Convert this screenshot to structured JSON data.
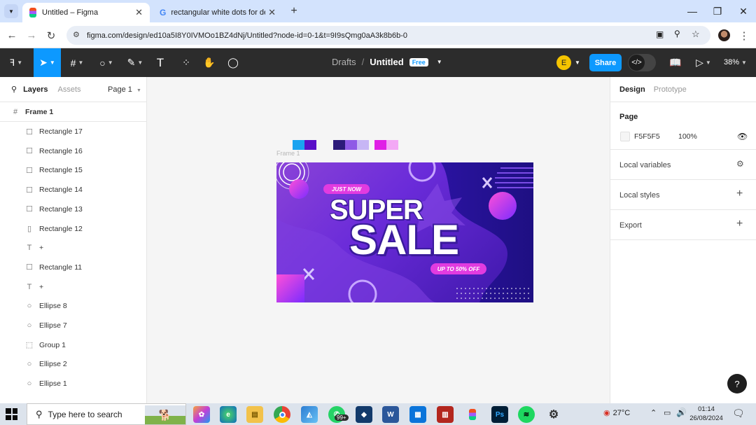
{
  "browser": {
    "tabs": [
      {
        "title": "Untitled – Figma",
        "active": true
      },
      {
        "title": "rectangular white dots for desi",
        "active": false
      }
    ],
    "url": "figma.com/design/ed10a5I8Y0IVMOo1BZ4dNj/Untitled?node-id=0-1&t=9I9sQmg0aA3k8b6b-0"
  },
  "toolbar": {
    "breadcrumb_drafts": "Drafts",
    "separator": "/",
    "file_name": "Untitled",
    "plan_badge": "Free",
    "avatar_initial": "E",
    "share_label": "Share",
    "zoom": "38%"
  },
  "left_panel": {
    "tabs": [
      "Layers",
      "Assets"
    ],
    "page_selector": "Page 1",
    "frame_name": "Frame 1",
    "layers": [
      {
        "name": "Rectangle 17",
        "icon": "rectangle-icon"
      },
      {
        "name": "Rectangle 16",
        "icon": "rectangle-icon"
      },
      {
        "name": "Rectangle 15",
        "icon": "rectangle-icon"
      },
      {
        "name": "Rectangle 14",
        "icon": "rectangle-icon"
      },
      {
        "name": "Rectangle 13",
        "icon": "rectangle-icon"
      },
      {
        "name": "Rectangle 12",
        "icon": "thin-rectangle-icon"
      },
      {
        "name": "+",
        "icon": "text-icon"
      },
      {
        "name": "Rectangle 11",
        "icon": "rectangle-icon"
      },
      {
        "name": "+",
        "icon": "text-icon"
      },
      {
        "name": "Ellipse 8",
        "icon": "ellipse-icon"
      },
      {
        "name": "Ellipse 7",
        "icon": "ellipse-icon"
      },
      {
        "name": "Group 1",
        "icon": "group-icon"
      },
      {
        "name": "Ellipse 2",
        "icon": "ellipse-icon"
      },
      {
        "name": "Ellipse 1",
        "icon": "ellipse-icon"
      }
    ]
  },
  "canvas": {
    "frame_label": "Frame 1",
    "swatches": [
      "#1aa3f0",
      "#5a0fc8",
      "#2d1b7a",
      "#8f5ae6",
      "#c7b6f5",
      "#e020e6",
      "#f3a8f5"
    ],
    "banner": {
      "badge_top": "JUST NOW",
      "headline_1": "SUPER",
      "headline_2": "SALE",
      "badge_bottom": "UP TO 50% OFF"
    }
  },
  "right_panel": {
    "tabs": [
      "Design",
      "Prototype"
    ],
    "page_heading": "Page",
    "page_color": "F5F5F5",
    "page_opacity": "100%",
    "sections": [
      "Local variables",
      "Local styles",
      "Export"
    ]
  },
  "taskbar": {
    "search_placeholder": "Type here to search",
    "temperature": "27°C",
    "time": "01:14",
    "date": "26/08/2024",
    "whatsapp_badge": "99+"
  },
  "help_label": "?",
  "colors": {
    "accent": "#0d99ff",
    "toolbar_bg": "#2c2c2c",
    "banner_purple": "#6a2bd9"
  }
}
